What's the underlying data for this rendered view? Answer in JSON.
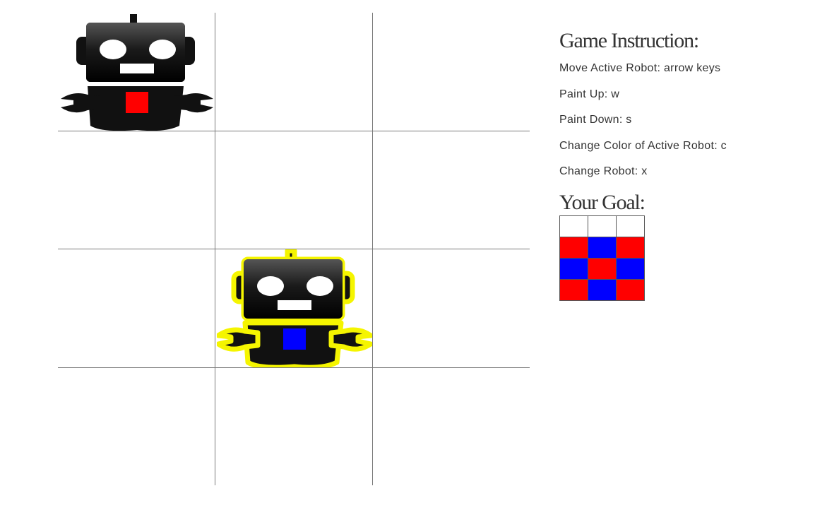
{
  "colors": {
    "red": "#ff0000",
    "blue": "#0000ff",
    "white": "#ffffff",
    "robot_body": "#111111",
    "active_outline": "#f5f500"
  },
  "board": {
    "rows": 4,
    "cols": 3,
    "robots": [
      {
        "row": 0,
        "col": 0,
        "paint_color": "red",
        "active": false,
        "icon": "robot-icon"
      },
      {
        "row": 2,
        "col": 1,
        "paint_color": "blue",
        "active": true,
        "icon": "robot-icon"
      }
    ]
  },
  "instructions": {
    "title": "Game Instruction:",
    "items": [
      "Move Active Robot: arrow keys",
      "Paint Up: w",
      "Paint Down: s",
      "Change Color of Active Robot: c",
      "Change Robot: x"
    ]
  },
  "goal": {
    "title": "Your Goal:",
    "grid": [
      [
        "white",
        "white",
        "white"
      ],
      [
        "red",
        "blue",
        "red"
      ],
      [
        "blue",
        "red",
        "blue"
      ],
      [
        "red",
        "blue",
        "red"
      ]
    ]
  }
}
